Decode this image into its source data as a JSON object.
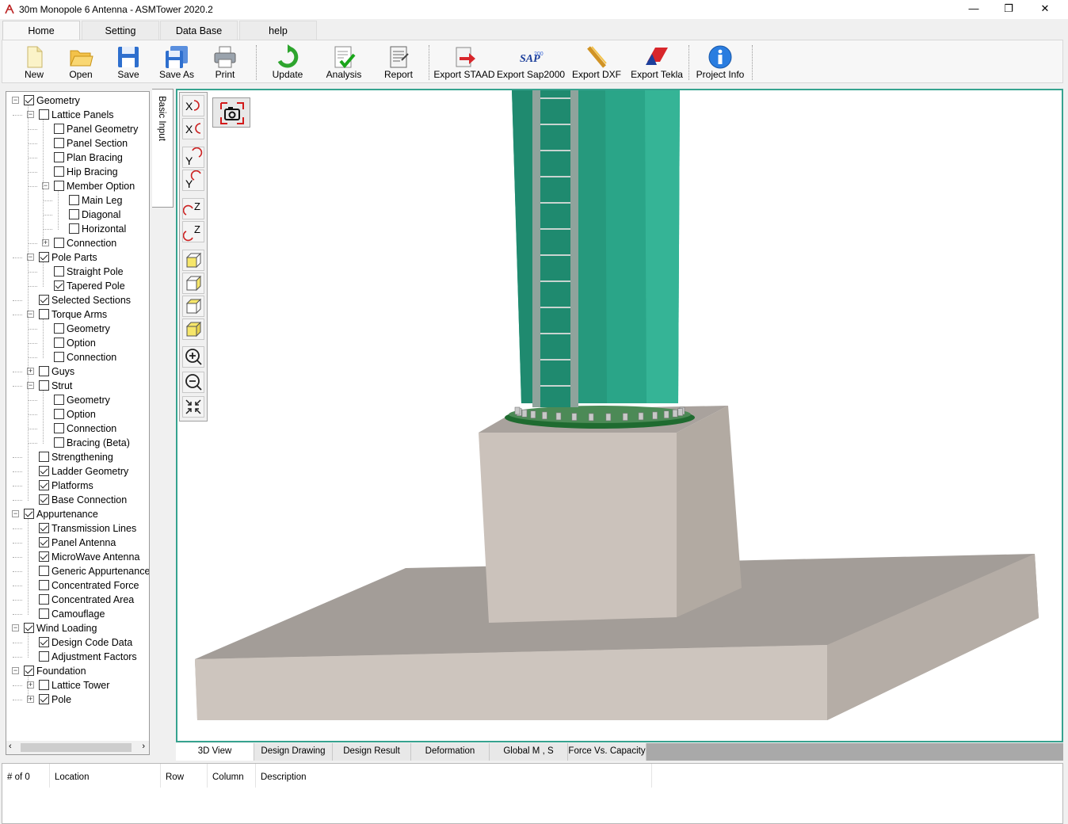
{
  "window": {
    "title": "30m Monopole 6 Antenna - ASMTower 2020.2",
    "minimize": "—",
    "restore": "❐",
    "close": "✕"
  },
  "ribbon_tabs": [
    {
      "label": "Home",
      "active": true
    },
    {
      "label": "Setting"
    },
    {
      "label": "Data Base"
    },
    {
      "label": "help"
    }
  ],
  "toolbar": [
    {
      "label": "New",
      "icon": "new-file-icon"
    },
    {
      "label": "Open",
      "icon": "open-folder-icon"
    },
    {
      "label": "Save",
      "icon": "save-icon"
    },
    {
      "label": "Save As",
      "icon": "save-as-icon"
    },
    {
      "label": "Print",
      "icon": "printer-icon"
    },
    {
      "label": "Update",
      "icon": "refresh-icon"
    },
    {
      "label": "Analysis",
      "icon": "analysis-icon"
    },
    {
      "label": "Report",
      "icon": "report-icon"
    },
    {
      "label": "Export STAAD",
      "icon": "export-staad-icon"
    },
    {
      "label": "Export Sap2000",
      "icon": "sap2000-icon"
    },
    {
      "label": "Export DXF",
      "icon": "dxf-icon"
    },
    {
      "label": "Export Tekla",
      "icon": "tekla-icon"
    },
    {
      "label": "Project Info",
      "icon": "info-icon"
    }
  ],
  "tree": [
    {
      "label": "Geometry",
      "checked": true,
      "level": 0,
      "expander": "minus"
    },
    {
      "label": "Lattice Panels",
      "checked": false,
      "level": 1,
      "expander": "minus"
    },
    {
      "label": "Panel Geometry",
      "checked": false,
      "level": 2
    },
    {
      "label": "Panel Section",
      "checked": false,
      "level": 2
    },
    {
      "label": "Plan Bracing",
      "checked": false,
      "level": 2
    },
    {
      "label": "Hip Bracing",
      "checked": false,
      "level": 2
    },
    {
      "label": "Member Option",
      "checked": false,
      "level": 2,
      "expander": "minus"
    },
    {
      "label": "Main Leg",
      "checked": false,
      "level": 3
    },
    {
      "label": "Diagonal",
      "checked": false,
      "level": 3
    },
    {
      "label": "Horizontal",
      "checked": false,
      "level": 3
    },
    {
      "label": "Connection",
      "checked": false,
      "level": 2,
      "expander": "plus"
    },
    {
      "label": "Pole Parts",
      "checked": true,
      "level": 1,
      "expander": "minus"
    },
    {
      "label": "Straight Pole",
      "checked": false,
      "level": 2
    },
    {
      "label": "Tapered Pole",
      "checked": true,
      "level": 2
    },
    {
      "label": "Selected Sections",
      "checked": true,
      "level": 1
    },
    {
      "label": "Torque Arms",
      "checked": false,
      "level": 1,
      "expander": "minus"
    },
    {
      "label": "Geometry",
      "checked": false,
      "level": 2
    },
    {
      "label": "Option",
      "checked": false,
      "level": 2
    },
    {
      "label": "Connection",
      "checked": false,
      "level": 2
    },
    {
      "label": "Guys",
      "checked": false,
      "level": 1,
      "expander": "plus"
    },
    {
      "label": "Strut",
      "checked": false,
      "level": 1,
      "expander": "minus"
    },
    {
      "label": "Geometry",
      "checked": false,
      "level": 2
    },
    {
      "label": "Option",
      "checked": false,
      "level": 2
    },
    {
      "label": "Connection",
      "checked": false,
      "level": 2
    },
    {
      "label": "Bracing (Beta)",
      "checked": false,
      "level": 2
    },
    {
      "label": "Strengthening",
      "checked": false,
      "level": 1
    },
    {
      "label": "Ladder Geometry",
      "checked": true,
      "level": 1
    },
    {
      "label": "Platforms",
      "checked": true,
      "level": 1
    },
    {
      "label": "Base Connection",
      "checked": true,
      "level": 1
    },
    {
      "label": "Appurtenance",
      "checked": true,
      "level": 0,
      "expander": "minus"
    },
    {
      "label": "Transmission Lines",
      "checked": true,
      "level": 1
    },
    {
      "label": "Panel Antenna",
      "checked": true,
      "level": 1
    },
    {
      "label": "MicroWave Antenna",
      "checked": true,
      "level": 1
    },
    {
      "label": "Generic Appurtenance",
      "checked": false,
      "level": 1
    },
    {
      "label": "Concentrated Force",
      "checked": false,
      "level": 1
    },
    {
      "label": "Concentrated Area",
      "checked": false,
      "level": 1
    },
    {
      "label": "Camouflage",
      "checked": false,
      "level": 1
    },
    {
      "label": "Wind Loading",
      "checked": true,
      "level": 0,
      "expander": "minus"
    },
    {
      "label": "Design Code Data",
      "checked": true,
      "level": 1
    },
    {
      "label": "Adjustment Factors",
      "checked": false,
      "level": 1
    },
    {
      "label": "Foundation",
      "checked": true,
      "level": 0,
      "expander": "minus"
    },
    {
      "label": "Lattice Tower",
      "checked": false,
      "level": 1,
      "expander": "plus"
    },
    {
      "label": "Pole",
      "checked": true,
      "level": 1,
      "expander": "plus"
    }
  ],
  "side_tab": "Basic Input",
  "view_tools": [
    "rotate-x-positive-icon",
    "rotate-x-negative-icon",
    "rotate-y-positive-icon",
    "rotate-y-negative-icon",
    "rotate-z-positive-icon",
    "rotate-z-negative-icon",
    "view-cube-front-icon",
    "view-cube-side-icon",
    "view-cube-top-icon",
    "view-cube-iso-icon",
    "zoom-in-icon",
    "zoom-out-icon",
    "fit-view-icon"
  ],
  "bottom_tabs": [
    {
      "label": "3D View",
      "active": true
    },
    {
      "label": "Design Drawing"
    },
    {
      "label": "Design Result"
    },
    {
      "label": "Deformation"
    },
    {
      "label": "Global M , S"
    },
    {
      "label": "Force Vs. Capacity"
    }
  ],
  "error_list": {
    "columns": [
      "# of 0",
      "Location",
      "Row",
      "Column",
      "Description"
    ]
  },
  "colors": {
    "accent": "#36a38f",
    "pole": "#2aa588",
    "pole_dark": "#1f8a6f",
    "pedestal": "#c9c0b8",
    "slab_top": "#a39d98"
  }
}
